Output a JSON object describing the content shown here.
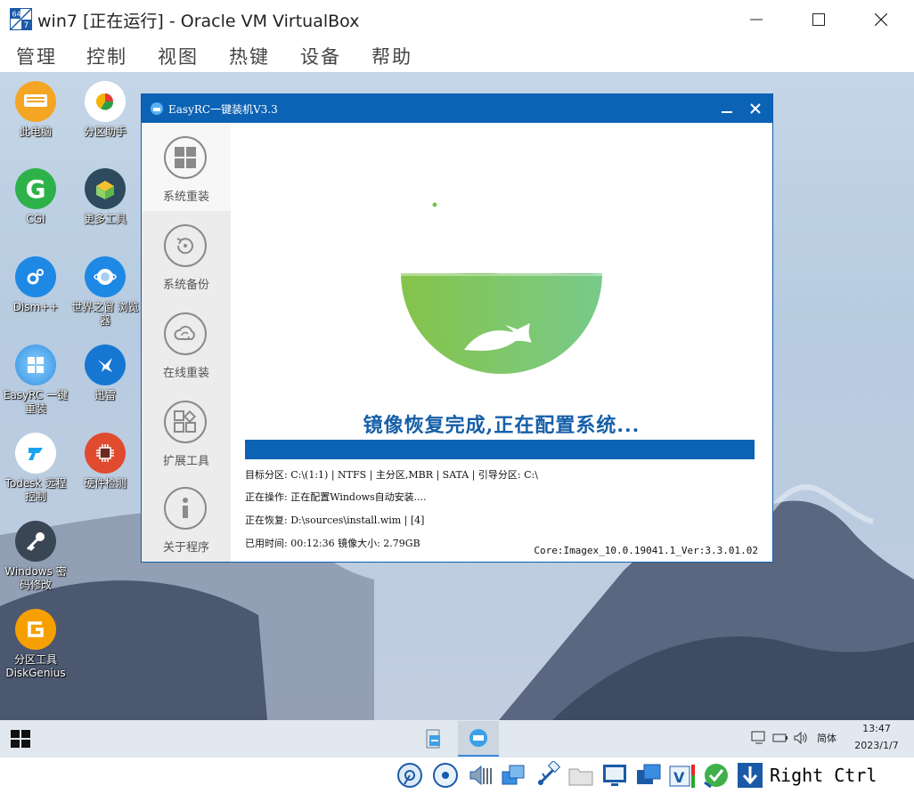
{
  "window": {
    "title": "win7 [正在运行] - Oracle VM VirtualBox",
    "app_icon_text": "64 7"
  },
  "menu": [
    "管理",
    "控制",
    "视图",
    "热键",
    "设备",
    "帮助"
  ],
  "desktop_icons": [
    {
      "label": "此电脑",
      "icon": "computer-icon",
      "color": "#f5a524"
    },
    {
      "label": "分区助手",
      "icon": "partition-assistant-icon",
      "color": "#ffffff"
    },
    {
      "label": "CGI",
      "icon": "cgi-icon",
      "color": "#2db24a"
    },
    {
      "label": "更多工具",
      "icon": "toolbox-icon",
      "color": "#2d4a5e"
    },
    {
      "label": "Dism++",
      "icon": "dism-gear-icon",
      "color": "#1e88e5"
    },
    {
      "label": "世界之窗 浏览器",
      "icon": "browser-globe-icon",
      "color": "#1e88e5"
    },
    {
      "label": "EasyRC 一键重装",
      "icon": "windows-logo-icon",
      "color": "#3aa0e8"
    },
    {
      "label": "迅雷",
      "icon": "thunder-bird-icon",
      "color": "#1677d2"
    },
    {
      "label": "Todesk 远程控制",
      "icon": "todesk-icon",
      "color": "#ffffff"
    },
    {
      "label": "硬件检测",
      "icon": "chip-icon",
      "color": "#e04b2f"
    },
    {
      "label": "Windows 密码修改",
      "icon": "key-icon",
      "color": "#3b4654"
    },
    {
      "label": "分区工具 DiskGenius",
      "icon": "diskgenius-icon",
      "color": "#f5a000"
    }
  ],
  "easyrc": {
    "title": "EasyRC一键装机V3.3",
    "sidebar": [
      {
        "label": "系统重装",
        "icon": "windows-tiles-icon"
      },
      {
        "label": "系统备份",
        "icon": "backup-restore-icon"
      },
      {
        "label": "在线重装",
        "icon": "cloud-sync-icon"
      },
      {
        "label": "扩展工具",
        "icon": "apps-grid-icon"
      },
      {
        "label": "关于程序",
        "icon": "info-icon"
      }
    ],
    "headline": "镜像恢复完成,正在配置系统...",
    "progress_fraction": 1.0,
    "target_partition": "目标分区: C:\\(1:1) | NTFS | 主分区,MBR | SATA | 引导分区: C:\\",
    "current_op": "正在操作: 正在配置Windows自动安装....",
    "restoring": "正在恢复: D:\\sources\\install.wim | [4]",
    "elapsed": "已用时间: 00:12:36   镜像大小: 2.79GB",
    "core": "Core:Imagex_10.0.19041.1_Ver:3.3.01.02"
  },
  "taskbar": {
    "tray_lang": "简体",
    "time": "13:47",
    "date": "2023/1/7"
  },
  "vbox_status": {
    "host_key": "Right Ctrl"
  },
  "colors": {
    "accent_blue": "#0c62b4",
    "headline_blue": "#155fa8",
    "bowl_green_left": "#7cc24a",
    "bowl_green_right": "#7acb86"
  }
}
